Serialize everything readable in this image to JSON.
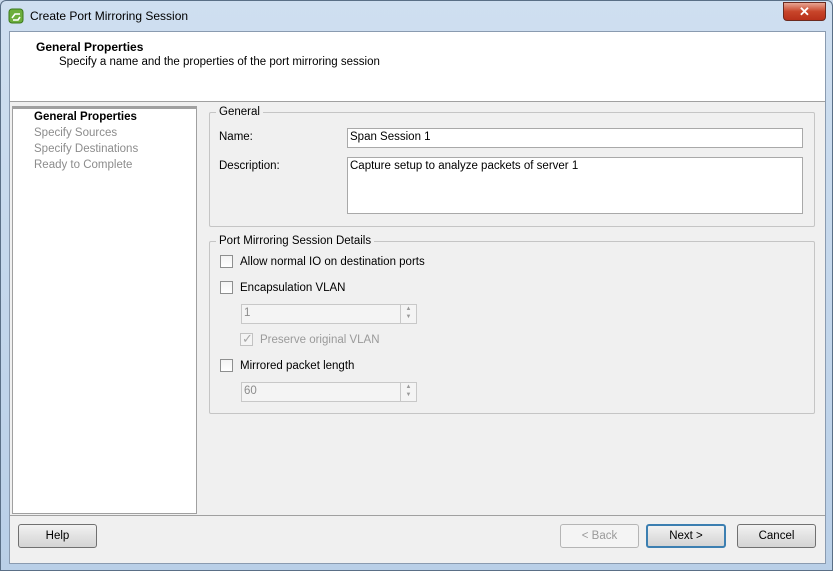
{
  "window": {
    "title": "Create Port Mirroring Session",
    "close_label": "✕"
  },
  "header": {
    "title": "General Properties",
    "subtitle": "Specify a name and the properties of the port mirroring session"
  },
  "nav": {
    "items": [
      {
        "label": "General Properties",
        "active": true
      },
      {
        "label": "Specify Sources",
        "active": false
      },
      {
        "label": "Specify Destinations",
        "active": false
      },
      {
        "label": "Ready to Complete",
        "active": false
      }
    ]
  },
  "general": {
    "legend": "General",
    "name_label": "Name:",
    "name_value": "Span Session 1",
    "description_label": "Description:",
    "description_value": "Capture setup to analyze packets of server 1"
  },
  "details": {
    "legend": "Port Mirroring Session Details",
    "allow_io_label": "Allow normal IO on destination ports",
    "encap_vlan_label": "Encapsulation VLAN",
    "encap_vlan_value": "1",
    "preserve_vlan_label": "Preserve original VLAN",
    "mirrored_length_label": "Mirrored packet length",
    "mirrored_length_value": "60"
  },
  "footer": {
    "help_label": "Help",
    "back_label": "< Back",
    "next_label": "Next >",
    "cancel_label": "Cancel"
  },
  "colors": {
    "titlebar": "#c9d9ec",
    "close": "#c8452a",
    "default_button_border": "#3c7fb1"
  }
}
